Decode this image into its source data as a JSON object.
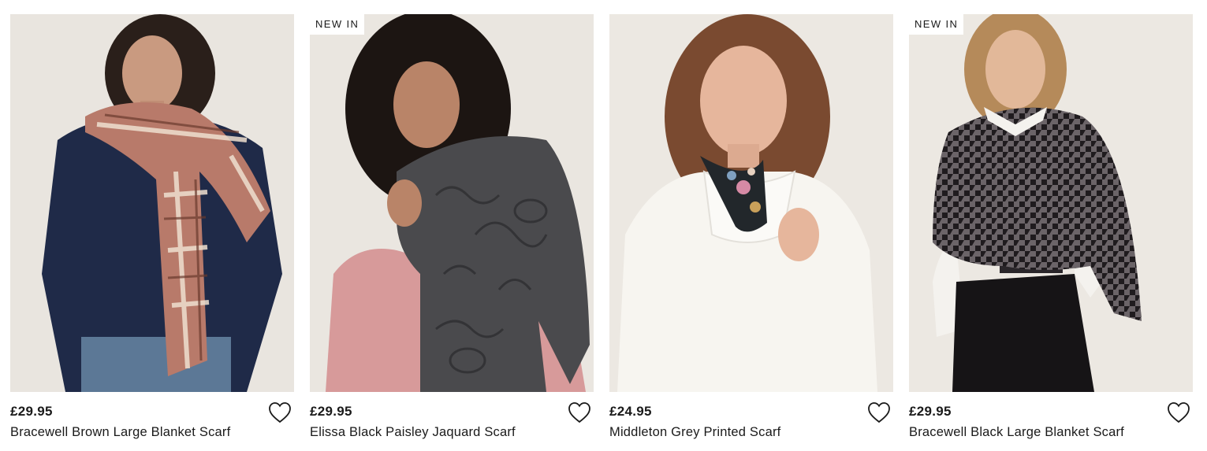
{
  "products": [
    {
      "badge": "",
      "price": "£29.95",
      "name": "Bracewell Brown Large Blanket Scarf",
      "image_icon": "model-brown-check-scarf-photo",
      "scarf_color": "#b2786a"
    },
    {
      "badge": "NEW IN",
      "price": "£29.95",
      "name": "Elissa Black Paisley Jaquard Scarf",
      "image_icon": "model-black-paisley-scarf-photo",
      "scarf_color": "#3c3c3e"
    },
    {
      "badge": "",
      "price": "£24.95",
      "name": "Middleton Grey Printed Scarf",
      "image_icon": "model-printed-neck-scarf-photo",
      "scarf_color": "#22272b"
    },
    {
      "badge": "NEW IN",
      "price": "£29.95",
      "name": "Bracewell Black Large Blanket Scarf",
      "image_icon": "model-black-houndstooth-scarf-photo",
      "scarf_color": "#3a3438"
    }
  ],
  "wishlist_icon": "heart-outline-icon"
}
